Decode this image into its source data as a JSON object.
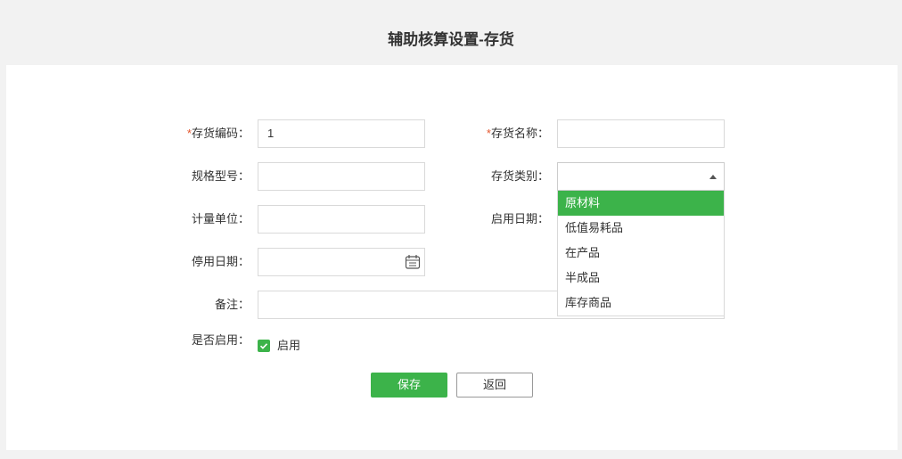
{
  "title": "辅助核算设置-存货",
  "form": {
    "code_label": "存货编码：",
    "code_value": "1",
    "name_label": "存货名称：",
    "name_value": "",
    "spec_label": "规格型号：",
    "category_label": "存货类别：",
    "unit_label": "计量单位：",
    "start_date_label": "启用日期：",
    "stop_date_label": "停用日期：",
    "remark_label": "备注：",
    "enabled_label": "是否启用：",
    "enabled_text": "启用",
    "enabled": true,
    "required_mark": "*"
  },
  "category_options": [
    "原材料",
    "低值易耗品",
    "在产品",
    "半成品",
    "库存商品"
  ],
  "buttons": {
    "save": "保存",
    "back": "返回"
  },
  "colors": {
    "accent": "#3cb34a",
    "required": "#e4572e"
  }
}
